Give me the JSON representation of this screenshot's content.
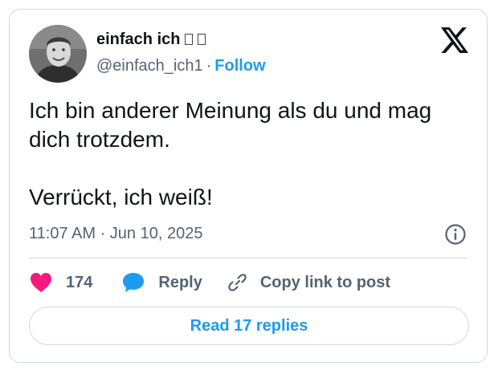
{
  "author": {
    "display_name": "einfach ich",
    "handle": "@einfach_ich1",
    "separator": "·",
    "follow_label": "Follow",
    "avatar": "profile-photo"
  },
  "tweet": {
    "line1": "Ich bin anderer Meinung als du und mag dich trotzdem.",
    "line2": "Verrückt, ich weiß!",
    "timestamp": "11:07 AM · Jun 10, 2025"
  },
  "actions": {
    "like_count": "174",
    "reply_label": "Reply",
    "copy_label": "Copy link to post"
  },
  "footer": {
    "read_replies_label": "Read 17 replies"
  },
  "icons": {
    "brand": "x-logo-icon",
    "info": "info-icon",
    "like": "heart-icon",
    "reply": "speech-bubble-icon",
    "copy": "link-icon"
  },
  "colors": {
    "accent": "#1d9bf0",
    "like": "#f91880",
    "text": "#0f1419",
    "secondary": "#536471",
    "border": "#cfd9de"
  }
}
